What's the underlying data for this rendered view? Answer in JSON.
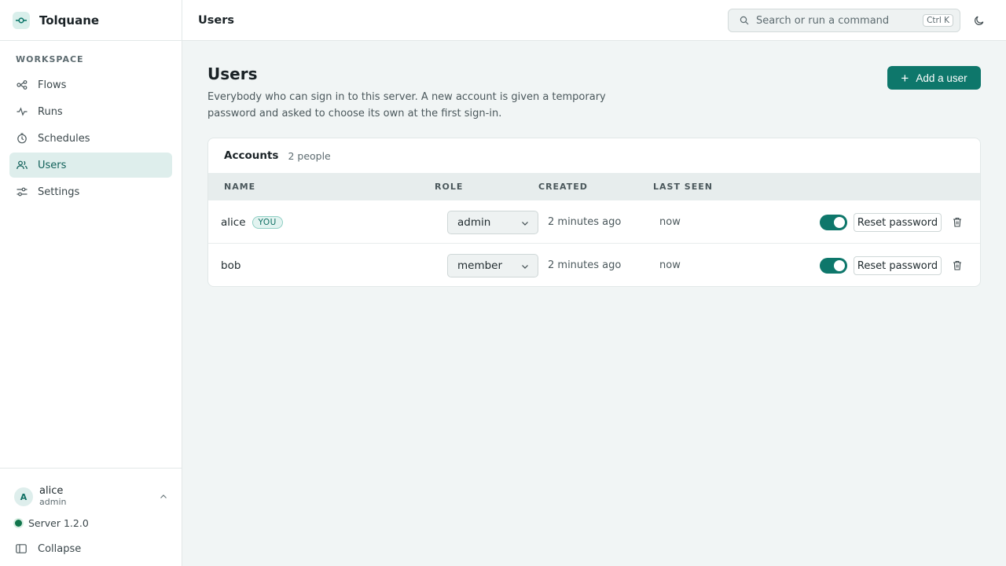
{
  "app": {
    "name": "Tolquane",
    "accent": "#0e776b"
  },
  "sidebar": {
    "section_label": "WORKSPACE",
    "items": [
      {
        "label": "Flows",
        "icon": "flows-icon",
        "active": false
      },
      {
        "label": "Runs",
        "icon": "activity-icon",
        "active": false
      },
      {
        "label": "Schedules",
        "icon": "clock-icon",
        "active": false
      },
      {
        "label": "Users",
        "icon": "users-icon",
        "active": true
      },
      {
        "label": "Settings",
        "icon": "sliders-icon",
        "active": false
      }
    ],
    "user": {
      "initial": "A",
      "name": "alice",
      "role": "admin"
    },
    "server": {
      "label": "Server 1.2.0",
      "status_color": "#11754c"
    },
    "collapse_label": "Collapse"
  },
  "topbar": {
    "title": "Users",
    "search_placeholder": "Search or run a command",
    "shortcut": "Ctrl K"
  },
  "page": {
    "title": "Users",
    "description": "Everybody who can sign in to this server. A new account is given a temporary password and asked to choose its own at the first sign-in.",
    "add_button": "Add a user"
  },
  "accounts": {
    "title": "Accounts",
    "count": "2 people",
    "columns": [
      "NAME",
      "ROLE",
      "CREATED",
      "LAST SEEN"
    ],
    "rows": [
      {
        "name": "alice",
        "badge": "YOU",
        "role": "admin",
        "created": "2 minutes ago",
        "last_seen": "now",
        "enabled": true,
        "reset_label": "Reset password"
      },
      {
        "name": "bob",
        "badge": "",
        "role": "member",
        "created": "2 minutes ago",
        "last_seen": "now",
        "enabled": true,
        "reset_label": "Reset password"
      }
    ]
  }
}
